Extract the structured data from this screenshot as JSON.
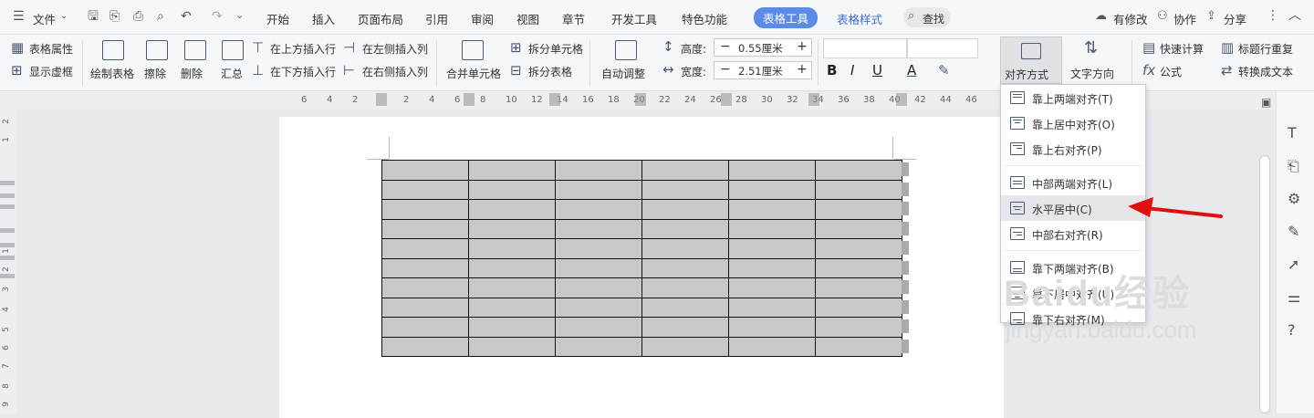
{
  "menu": {
    "file": "文件",
    "tabs": [
      "开始",
      "插入",
      "页面布局",
      "引用",
      "审阅",
      "视图",
      "章节",
      "开发工具",
      "特色功能"
    ],
    "active_tab": "表格工具",
    "style_tab": "表格样式",
    "search": "查找",
    "right": [
      "有修改",
      "协作",
      "分享"
    ]
  },
  "ribbon": {
    "table_props": "表格属性",
    "show_grid": "显示虚框",
    "draw_table": "绘制表格",
    "erase": "擦除",
    "delete": "删除",
    "summary": "汇总",
    "insert_above": "在上方插入行",
    "insert_below": "在下方插入行",
    "insert_left": "在左侧插入列",
    "insert_right": "在右侧插入列",
    "merge_cells": "合并单元格",
    "split_cells": "拆分单元格",
    "split_table": "拆分表格",
    "auto_adjust": "自动调整",
    "height_label": "高度:",
    "height_value": "0.55厘米",
    "width_label": "宽度:",
    "width_value": "2.51厘米",
    "align": "对齐方式",
    "text_dir": "文字方向",
    "quick_calc": "快速计算",
    "repeat_header": "标题行重复",
    "formula": "公式",
    "convert_text": "转换成文本"
  },
  "ruler_numbers": [
    "6",
    "4",
    "2",
    "2",
    "4",
    "6",
    "8",
    "10",
    "12",
    "14",
    "16",
    "18",
    "20",
    "22",
    "24",
    "26",
    "28",
    "30",
    "32",
    "34",
    "36",
    "38",
    "40",
    "42",
    "44",
    "46"
  ],
  "left_ruler_numbers": [
    "2",
    "1",
    "1",
    "2",
    "3",
    "4",
    "5",
    "6",
    "7",
    "8",
    "9",
    "10",
    "11",
    "12",
    "13"
  ],
  "dropdown": {
    "items": [
      {
        "label": "靠上两端对齐(T)",
        "group": 0
      },
      {
        "label": "靠上居中对齐(O)",
        "group": 0
      },
      {
        "label": "靠上右对齐(P)",
        "group": 0
      },
      {
        "label": "中部两端对齐(L)",
        "group": 1
      },
      {
        "label": "水平居中(C)",
        "group": 1,
        "highlighted": true
      },
      {
        "label": "中部右对齐(R)",
        "group": 1
      },
      {
        "label": "靠下两端对齐(B)",
        "group": 2
      },
      {
        "label": "靠下居中对齐(U)",
        "group": 2
      },
      {
        "label": "靠下右对齐(M)",
        "group": 2
      }
    ]
  },
  "table": {
    "rows": 10,
    "cols": 6
  },
  "watermark": {
    "brand": "Baidu经验",
    "url": "jingyan.baidu.com"
  },
  "colors": {
    "accent": "#5b8be6",
    "arrow": "#e01010",
    "cell": "#c8c8c8"
  }
}
